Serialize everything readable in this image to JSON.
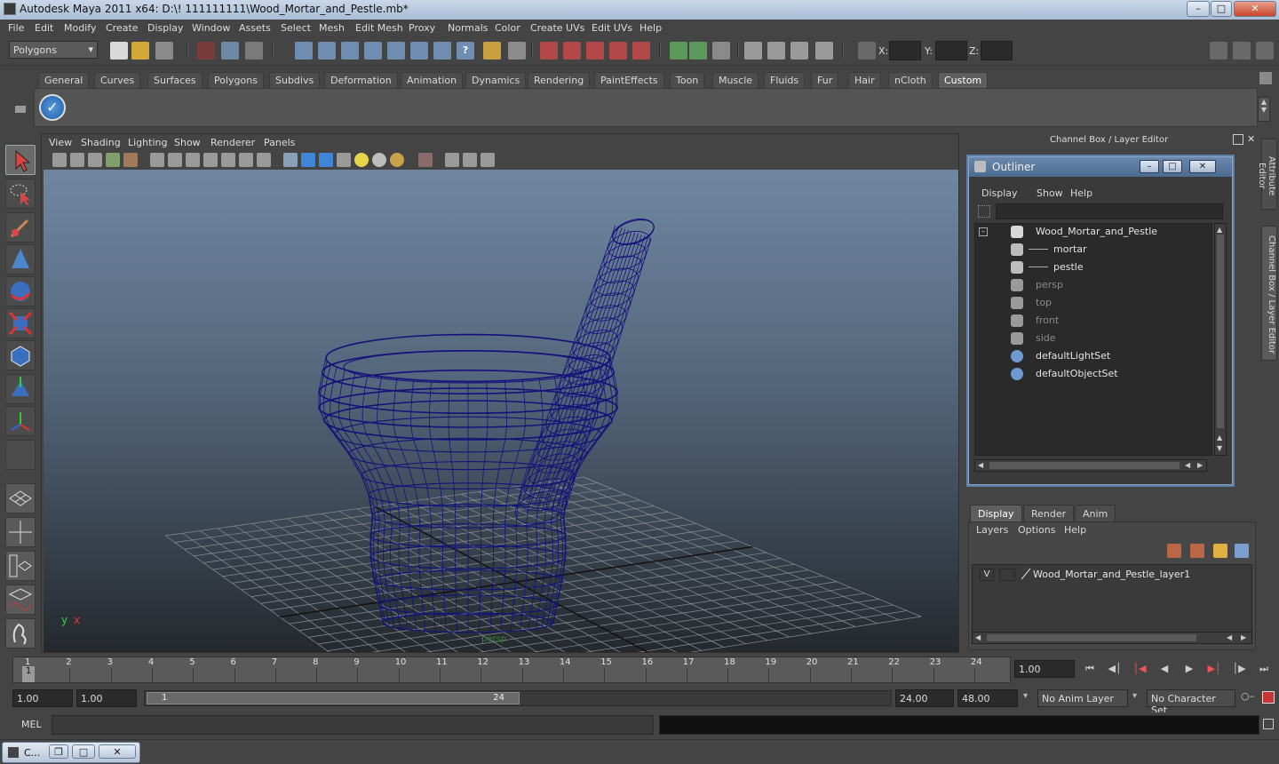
{
  "window": {
    "title": "Autodesk Maya 2011 x64: D:\\! 111111111\\Wood_Mortar_and_Pestle.mb*"
  },
  "menubar": [
    "File",
    "Edit",
    "Modify",
    "Create",
    "Display",
    "Window",
    "Assets",
    "Select",
    "Mesh",
    "Edit Mesh",
    "Proxy",
    "Normals",
    "Color",
    "Create UVs",
    "Edit UVs",
    "Help"
  ],
  "statusline": {
    "mode": "Polygons",
    "x_label": "X:",
    "y_label": "Y:",
    "z_label": "Z:"
  },
  "shelf": {
    "tabs": [
      "General",
      "Curves",
      "Surfaces",
      "Polygons",
      "Subdivs",
      "Deformation",
      "Animation",
      "Dynamics",
      "Rendering",
      "PaintEffects",
      "Toon",
      "Muscle",
      "Fluids",
      "Fur",
      "Hair",
      "nCloth",
      "Custom"
    ],
    "active_tab": "Custom"
  },
  "viewport": {
    "menu": [
      "View",
      "Shading",
      "Lighting",
      "Show",
      "Renderer",
      "Panels"
    ],
    "camera_label": "persp",
    "axis_y": "y",
    "axis_x": "x"
  },
  "rightpanel": {
    "header": "Channel Box / Layer Editor",
    "outliner": {
      "title": "Outliner",
      "menu": [
        "Display",
        "Show",
        "Help"
      ],
      "items": [
        {
          "label": "Wood_Mortar_and_Pestle",
          "icon": "group-icon",
          "depth": 0,
          "dim": false
        },
        {
          "label": "mortar",
          "icon": "mesh-icon",
          "depth": 1,
          "dim": false
        },
        {
          "label": "pestle",
          "icon": "mesh-icon",
          "depth": 1,
          "dim": false
        },
        {
          "label": "persp",
          "icon": "camera-icon",
          "depth": 0,
          "dim": true
        },
        {
          "label": "top",
          "icon": "camera-icon",
          "depth": 0,
          "dim": true
        },
        {
          "label": "front",
          "icon": "camera-icon",
          "depth": 0,
          "dim": true
        },
        {
          "label": "side",
          "icon": "camera-icon",
          "depth": 0,
          "dim": true
        },
        {
          "label": "defaultLightSet",
          "icon": "set-icon",
          "depth": 0,
          "dim": false
        },
        {
          "label": "defaultObjectSet",
          "icon": "set-icon",
          "depth": 0,
          "dim": false
        }
      ]
    },
    "layer_tabs": [
      "Display",
      "Render",
      "Anim"
    ],
    "layer_active": "Display",
    "layer_menu": [
      "Layers",
      "Options",
      "Help"
    ],
    "layer": {
      "visibility": "V",
      "name": "Wood_Mortar_and_Pestle_layer1"
    }
  },
  "sidetabs": [
    "Attribute Editor",
    "Channel Box / Layer Editor"
  ],
  "timeslider": {
    "ticks": [
      1,
      2,
      3,
      4,
      5,
      6,
      7,
      8,
      9,
      10,
      11,
      12,
      13,
      14,
      15,
      16,
      17,
      18,
      19,
      20,
      21,
      22,
      23,
      24
    ],
    "current_marker": "1",
    "current_time": "1.00"
  },
  "rangeslider": {
    "start": "1.00",
    "playback_start": "1.00",
    "range_start_label": "1",
    "range_end_label": "24",
    "playback_end": "24.00",
    "end": "48.00",
    "anim_layer": "No Anim Layer",
    "character_set": "No Character Set"
  },
  "cmdline": {
    "label": "MEL"
  },
  "taskbar": {
    "label": "C..."
  },
  "colors": {
    "wireframe": "#12127a",
    "grid": "#8a8f96",
    "accent": "#5d7fa8"
  }
}
